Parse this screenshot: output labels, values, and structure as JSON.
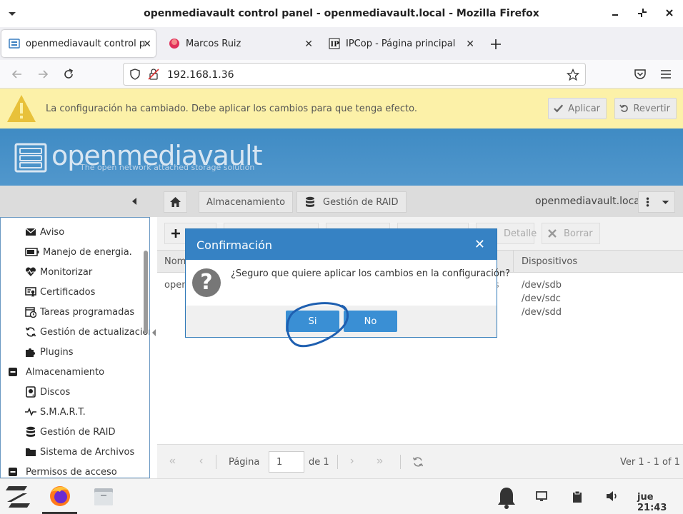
{
  "window": {
    "title": "openmediavault control panel - openmediavault.local - Mozilla Firefox"
  },
  "tabs": [
    {
      "label": "openmediavault control pa",
      "icon": "omv-icon",
      "active": true
    },
    {
      "label": "Marcos Ruiz",
      "icon": "circle-icon",
      "active": false
    },
    {
      "label": "IPCop - Página principal",
      "icon": "ipcop-icon",
      "active": false
    }
  ],
  "browser": {
    "url": "192.168.1.36"
  },
  "warning": {
    "message": "La configuración ha cambiado. Debe aplicar los cambios para que tenga efecto.",
    "apply_label": "Aplicar",
    "revert_label": "Revertir"
  },
  "header": {
    "logo": "openmediavault",
    "tagline": "The open network attached storage solution"
  },
  "breadcrumb": {
    "items": [
      "Almacenamiento",
      "Gestión de RAID"
    ],
    "hostname": "openmediavault.local"
  },
  "sidebar": {
    "items": [
      {
        "label": "Aviso",
        "icon": "mail-icon"
      },
      {
        "label": "Manejo de energia.",
        "icon": "battery-icon"
      },
      {
        "label": "Monitorizar",
        "icon": "heartbeat-icon"
      },
      {
        "label": "Certificados",
        "icon": "certificate-icon"
      },
      {
        "label": "Tareas programadas",
        "icon": "calendar-clock-icon"
      },
      {
        "label": "Gestión de actualizaciones",
        "icon": "refresh-icon"
      },
      {
        "label": "Plugins",
        "icon": "puzzle-icon"
      },
      {
        "label": "Almacenamiento",
        "icon": "collapse-icon",
        "section": true
      },
      {
        "label": "Discos",
        "icon": "disk-icon"
      },
      {
        "label": "S.M.A.R.T.",
        "icon": "pulse-icon"
      },
      {
        "label": "Gestión de RAID",
        "icon": "database-icon"
      },
      {
        "label": "Sistema de Archivos",
        "icon": "folder-icon"
      },
      {
        "label": "Permisos de acceso",
        "icon": "collapse-icon",
        "section": true
      }
    ]
  },
  "toolbar": {
    "detail_label": "Detalle",
    "delete_label": "Borrar"
  },
  "grid": {
    "columns": [
      "Nom",
      "Dispositivos"
    ],
    "rows": [
      {
        "name": "open",
        "suffix": "s",
        "devices": [
          "/dev/sdb",
          "/dev/sdc",
          "/dev/sdd"
        ]
      }
    ]
  },
  "pager": {
    "page_label": "Página",
    "page_value": "1",
    "of_label": "de 1",
    "summary": "Ver 1 - 1 of 1"
  },
  "dialog": {
    "title": "Confirmación",
    "message": "¿Seguro que quiere aplicar los cambios en la configuración?",
    "yes_label": "Si",
    "no_label": "No"
  },
  "taskbar": {
    "clock": "jue 21:43"
  },
  "colors": {
    "warning_bg": "#fcf1a8",
    "header_blue": "#3f8bc4",
    "dialog_blue": "#3682c4",
    "button_blue": "#3a8fd4",
    "annotation_circle": "#1e5fb0"
  }
}
